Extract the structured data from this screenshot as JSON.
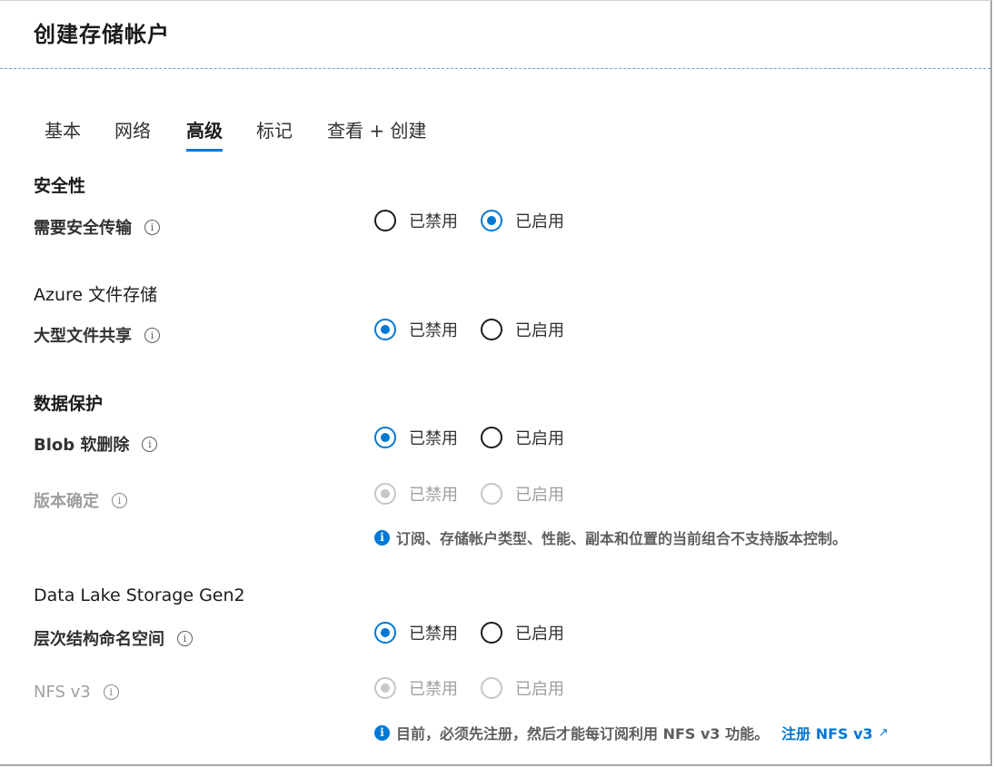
{
  "title": "创建存储帐户",
  "tabs": [
    {
      "label": "基本",
      "active": false
    },
    {
      "label": "网络",
      "active": false
    },
    {
      "label": "高级",
      "active": true
    },
    {
      "label": "标记",
      "active": false
    },
    {
      "label": "查看 + 创建",
      "active": false
    }
  ],
  "sections": {
    "security": "安全性",
    "azure_files": "Azure 文件存储",
    "data_protection": "数据保护",
    "data_lake": "Data Lake Storage Gen2"
  },
  "fields": {
    "secure_transfer": {
      "label": "需要安全传输",
      "selected": "已启用",
      "disabled": false
    },
    "large_file_shares": {
      "label": "大型文件共享",
      "selected": "已禁用",
      "disabled": false
    },
    "blob_soft_delete": {
      "label": "Blob 软删除",
      "selected": "已禁用",
      "disabled": false
    },
    "versioning": {
      "label": "版本确定",
      "selected": "已禁用",
      "disabled": true
    },
    "hierarchical_namespace": {
      "label": "层次结构命名空间",
      "selected": "已禁用",
      "disabled": false
    },
    "nfs_v3": {
      "label": "NFS v3",
      "selected": "已禁用",
      "disabled": true
    }
  },
  "options": {
    "disabled": "已禁用",
    "enabled": "已启用"
  },
  "info_glyph": "i",
  "notes": {
    "versioning": "订阅、存储帐户类型、性能、副本和位置的当前组合不支持版本控制。",
    "nfs": "目前，必须先注册，然后才能每订阅利用 NFS v3 功能。",
    "nfs_link": "注册 NFS v3"
  },
  "colors": {
    "accent": "#0078d4",
    "disabled": "#c8c6c4"
  }
}
